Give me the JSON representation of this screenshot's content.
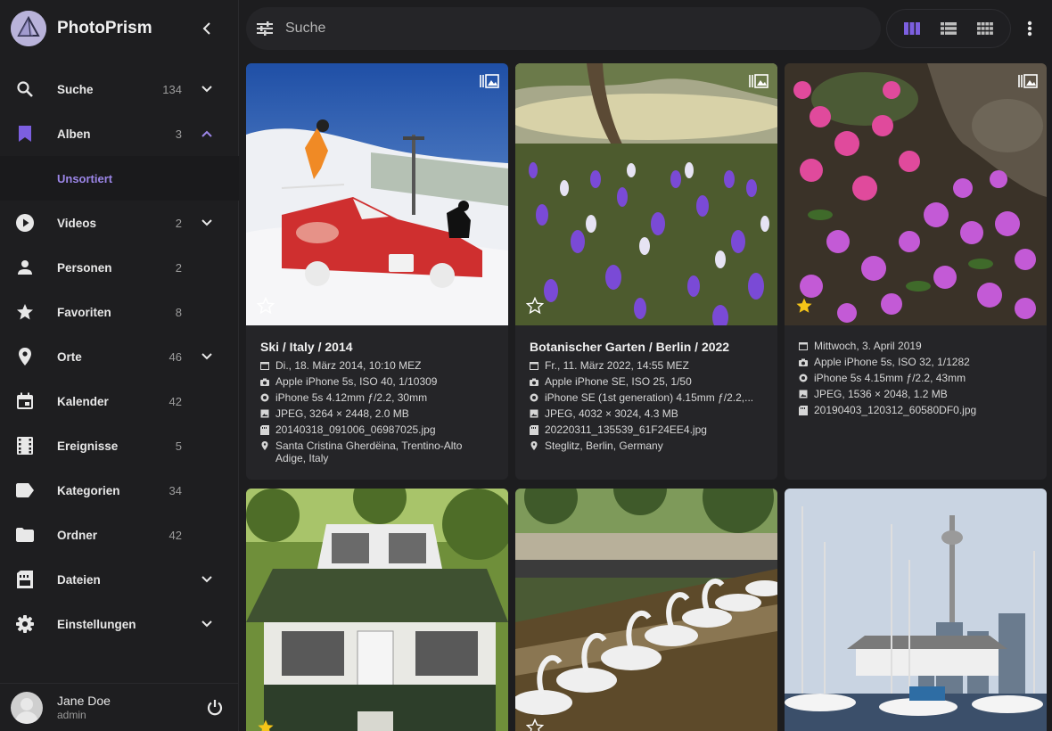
{
  "app": {
    "title": "PhotoPrism"
  },
  "nav": {
    "items": [
      {
        "label": "Suche",
        "count": "134",
        "chevron": "down"
      },
      {
        "label": "Alben",
        "count": "3",
        "chevron": "up"
      },
      {
        "label": "Videos",
        "count": "2",
        "chevron": "down"
      },
      {
        "label": "Personen",
        "count": "2"
      },
      {
        "label": "Favoriten",
        "count": "8"
      },
      {
        "label": "Orte",
        "count": "46",
        "chevron": "down"
      },
      {
        "label": "Kalender",
        "count": "42"
      },
      {
        "label": "Ereignisse",
        "count": "5"
      },
      {
        "label": "Kategorien",
        "count": "34"
      },
      {
        "label": "Ordner",
        "count": "42"
      },
      {
        "label": "Dateien",
        "chevron": "down"
      },
      {
        "label": "Einstellungen",
        "chevron": "down"
      }
    ],
    "sub_unsorted": "Unsortiert"
  },
  "user": {
    "name": "Jane Doe",
    "role": "admin"
  },
  "search": {
    "placeholder": "Suche"
  },
  "colors": {
    "accent": "#7c5fe0",
    "favorite": "#f5c518",
    "sub_active": "#9c86e8"
  },
  "cards": [
    {
      "title": "Ski / Italy / 2014",
      "date": "Di., 18. März 2014, 10:10 MEZ",
      "camera": "Apple iPhone 5s, ISO 40, 1/10309",
      "lens": "iPhone 5s 4.12mm ƒ/2.2, 30mm",
      "file": "JPEG, 3264 × 2448, 2.0 MB",
      "filename": "20140318_091006_06987025.jpg",
      "location": "Santa Cristina Gherdëina, Trentino-Alto Adige, Italy"
    },
    {
      "title": "Botanischer Garten / Berlin / 2022",
      "date": "Fr., 11. März 2022, 14:55 MEZ",
      "camera": "Apple iPhone SE, ISO 25, 1/50",
      "lens": "iPhone SE (1st generation) 4.15mm ƒ/2.2,...",
      "file": "JPEG, 4032 × 3024, 4.3 MB",
      "filename": "20220311_135539_61F24EE4.jpg",
      "location": "Steglitz, Berlin, Germany"
    },
    {
      "date": "Mittwoch, 3. April 2019",
      "camera": "Apple iPhone 5s, ISO 32, 1/1282",
      "lens": "iPhone 5s 4.15mm ƒ/2.2, 43mm",
      "file": "JPEG, 1536 × 2048, 1.2 MB",
      "filename": "20190403_120312_60580DF0.jpg"
    }
  ]
}
